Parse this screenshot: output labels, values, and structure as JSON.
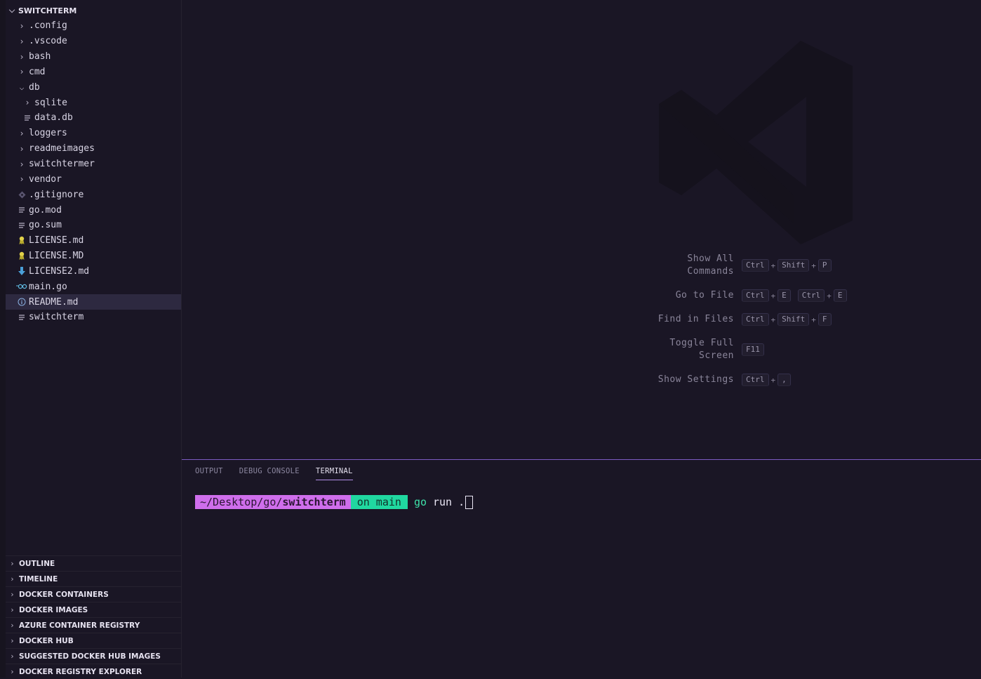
{
  "explorer": {
    "title": "SWITCHTERM",
    "items": [
      {
        "label": ".config",
        "icon": "chevron-right-icon",
        "depth": 1
      },
      {
        "label": ".vscode",
        "icon": "chevron-right-icon",
        "depth": 1
      },
      {
        "label": "bash",
        "icon": "chevron-right-icon",
        "depth": 1
      },
      {
        "label": "cmd",
        "icon": "chevron-right-icon",
        "depth": 1
      },
      {
        "label": "db",
        "icon": "chevron-down-icon",
        "depth": 1
      },
      {
        "label": "sqlite",
        "icon": "chevron-right-icon",
        "depth": 2
      },
      {
        "label": "data.db",
        "icon": "file-lines-icon",
        "depth": 2
      },
      {
        "label": "loggers",
        "icon": "chevron-right-icon",
        "depth": 1
      },
      {
        "label": "readmeimages",
        "icon": "chevron-right-icon",
        "depth": 1
      },
      {
        "label": "switchtermer",
        "icon": "chevron-right-icon",
        "depth": 1
      },
      {
        "label": "vendor",
        "icon": "chevron-right-icon",
        "depth": 1
      },
      {
        "label": ".gitignore",
        "icon": "git-icon",
        "depth": 1
      },
      {
        "label": "go.mod",
        "icon": "file-lines-icon",
        "depth": 1
      },
      {
        "label": "go.sum",
        "icon": "file-lines-icon",
        "depth": 1
      },
      {
        "label": "LICENSE.md",
        "icon": "license-icon",
        "depth": 1
      },
      {
        "label": "LICENSE.MD",
        "icon": "license-icon",
        "depth": 1
      },
      {
        "label": "LICENSE2.md",
        "icon": "markdown-icon",
        "depth": 1
      },
      {
        "label": "main.go",
        "icon": "go-icon",
        "depth": 1
      },
      {
        "label": "README.md",
        "icon": "info-icon",
        "depth": 1,
        "selected": true
      },
      {
        "label": "switchterm",
        "icon": "file-lines-icon",
        "depth": 1
      }
    ]
  },
  "panels": [
    "OUTLINE",
    "TIMELINE",
    "DOCKER CONTAINERS",
    "DOCKER IMAGES",
    "AZURE CONTAINER REGISTRY",
    "DOCKER HUB",
    "SUGGESTED DOCKER HUB IMAGES",
    "DOCKER REGISTRY EXPLORER"
  ],
  "welcome": {
    "shortcuts": [
      {
        "label": "Show All Commands",
        "keys": [
          [
            "Ctrl",
            "Shift",
            "P"
          ]
        ]
      },
      {
        "label": "Go to File",
        "keys": [
          [
            "Ctrl",
            "E"
          ],
          [
            "Ctrl",
            "E"
          ]
        ]
      },
      {
        "label": "Find in Files",
        "keys": [
          [
            "Ctrl",
            "Shift",
            "F"
          ]
        ]
      },
      {
        "label": "Toggle Full Screen",
        "keys": [
          [
            "F11"
          ]
        ]
      },
      {
        "label": "Show Settings",
        "keys": [
          [
            "Ctrl",
            ","
          ]
        ]
      }
    ]
  },
  "bottom_panel": {
    "tabs": [
      {
        "label": "OUTPUT",
        "active": false
      },
      {
        "label": "DEBUG CONSOLE",
        "active": false
      },
      {
        "label": "TERMINAL",
        "active": true
      }
    ],
    "terminal": {
      "path_prefix": "~/Desktop/go/",
      "path_dir": "switchterm",
      "branch": "on main",
      "command": "go",
      "args": "run ."
    }
  },
  "colors": {
    "background": "#1a1625",
    "accent": "#7d5cc2",
    "prompt_path": "#cf6eec",
    "prompt_branch": "#20d8a0"
  }
}
